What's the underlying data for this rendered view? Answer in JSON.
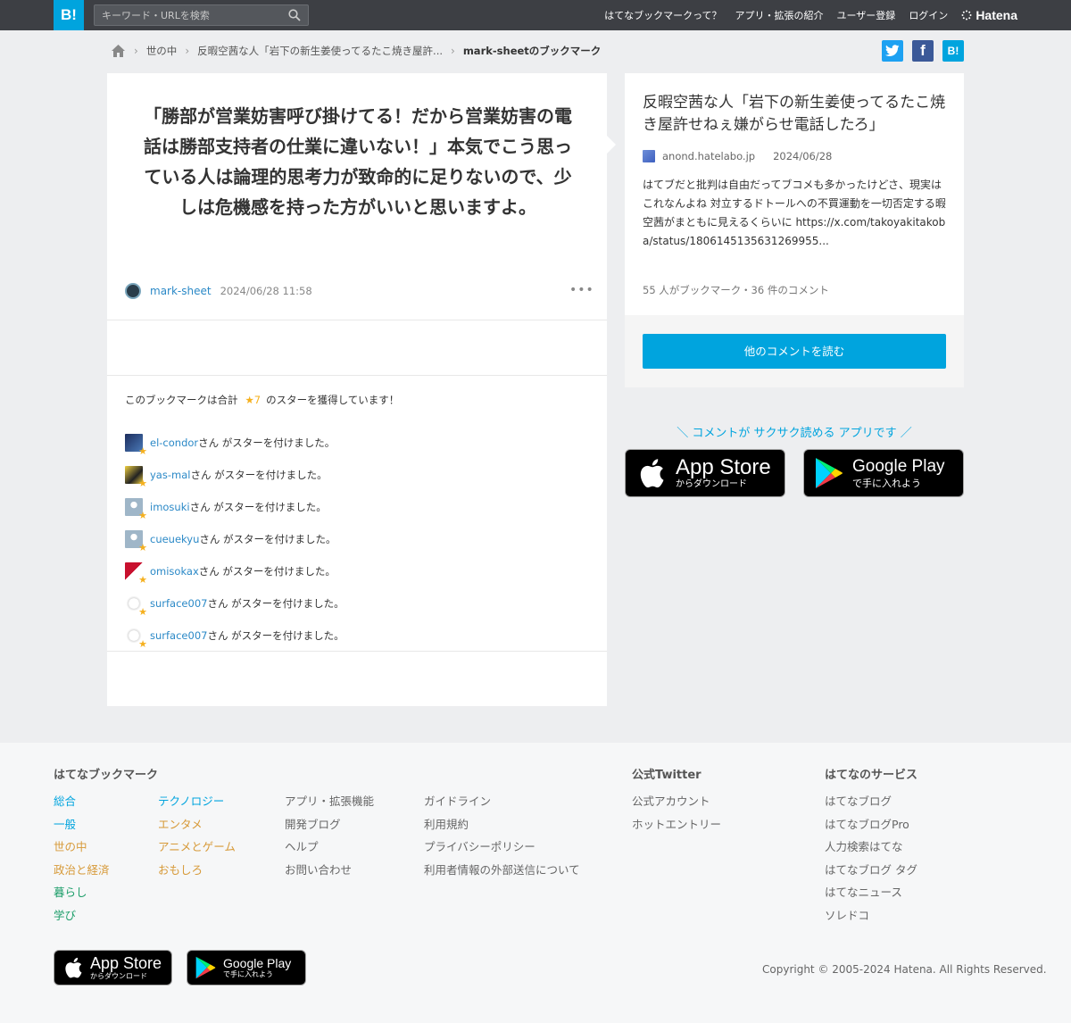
{
  "topbar": {
    "logo": "B!",
    "search_placeholder": "キーワード・URLを検索",
    "nav": [
      "はてなブックマークって？",
      "アプリ・拡張の紹介",
      "ユーザー登録",
      "ログイン"
    ],
    "brand": "Hatena"
  },
  "breadcrumb": {
    "items": [
      "世の中",
      "反暇空茜な人「岩下の新生姜使ってるたこ焼き屋許..."
    ],
    "current": "mark-sheetのブックマーク"
  },
  "share": {
    "facebook": "f",
    "hatena": "B!"
  },
  "bookmark": {
    "comment": "「勝部が営業妨害呼び掛けてる！だから営業妨害の電話は勝部支持者の仕業に違いない！」本気でこう思っている人は論理的思考力が致命的に足りないので、少しは危機感を持った方がいいと思いますよ。",
    "user": "mark-sheet",
    "datetime": "2024/06/28 11:58",
    "more": "•••"
  },
  "stars": {
    "summary_prefix": "このブックマークは合計",
    "star_count": "★7",
    "summary_suffix": "のスターを獲得しています！",
    "action": "さん がスターを付けました。",
    "users": [
      "el-condor",
      "yas-mal",
      "imosuki",
      "cueuekyu",
      "omisokax",
      "surface007",
      "surface007"
    ]
  },
  "entry": {
    "title": "反暇空茜な人「岩下の新生姜使ってるたこ焼き屋許せねぇ嫌がらせ電話したろ」",
    "domain": "anond.hatelabo.jp",
    "date": "2024/06/28",
    "description": "はてブだと批判は自由だってブコメも多かったけどさ、現実はこれなんよね 対立するドトールへの不買運動を一切否定する暇空茜がまともに見えるくらいに https://x.com/takoyakitakoba/status/1806145135631269955...",
    "count": "55 人がブックマーク・36 件のコメント",
    "read_button": "他のコメントを読む"
  },
  "promo": {
    "text": "＼ コメントが サクサク読める アプリです ／",
    "app_store": {
      "title": "App Store",
      "sub": "からダウンロード"
    },
    "google_play": {
      "title": "Google Play",
      "sub": "で手に入れよう"
    }
  },
  "footer": {
    "heading_bookmark": "はてなブックマーク",
    "heading_twitter": "公式Twitter",
    "heading_services": "はてなのサービス",
    "categories1": [
      "総合",
      "一般",
      "世の中",
      "政治と経済",
      "暮らし",
      "学び"
    ],
    "categories2": [
      "テクノロジー",
      "エンタメ",
      "アニメとゲーム",
      "おもしろ"
    ],
    "links1": [
      "アプリ・拡張機能",
      "開発ブログ",
      "ヘルプ",
      "お問い合わせ"
    ],
    "links2": [
      "ガイドライン",
      "利用規約",
      "プライバシーポリシー",
      "利用者情報の外部送信について"
    ],
    "twitter_links": [
      "公式アカウント",
      "ホットエントリー"
    ],
    "services": [
      "はてなブログ",
      "はてなブログPro",
      "人力検索はてな",
      "はてなブログ タグ",
      "はてなニュース",
      "ソレドコ"
    ],
    "copyright": "Copyright © 2005-2024 Hatena. All Rights Reserved."
  },
  "colors": {
    "accent": "#00a4de",
    "link": "#2b89c7",
    "star": "#f5b01e",
    "twitter": "#1da1f2",
    "facebook": "#3b5998",
    "category_colors": {
      "総合": "#00a4de",
      "一般": "#00a4de",
      "世の中": "#d79a39",
      "政治と経済": "#d79a39",
      "暮らし": "#1d9e6a",
      "学び": "#1d9e6a",
      "テクノロジー": "#00a4de",
      "エンタメ": "#d79a39",
      "アニメとゲーム": "#d79a39",
      "おもしろ": "#d79a39"
    }
  }
}
